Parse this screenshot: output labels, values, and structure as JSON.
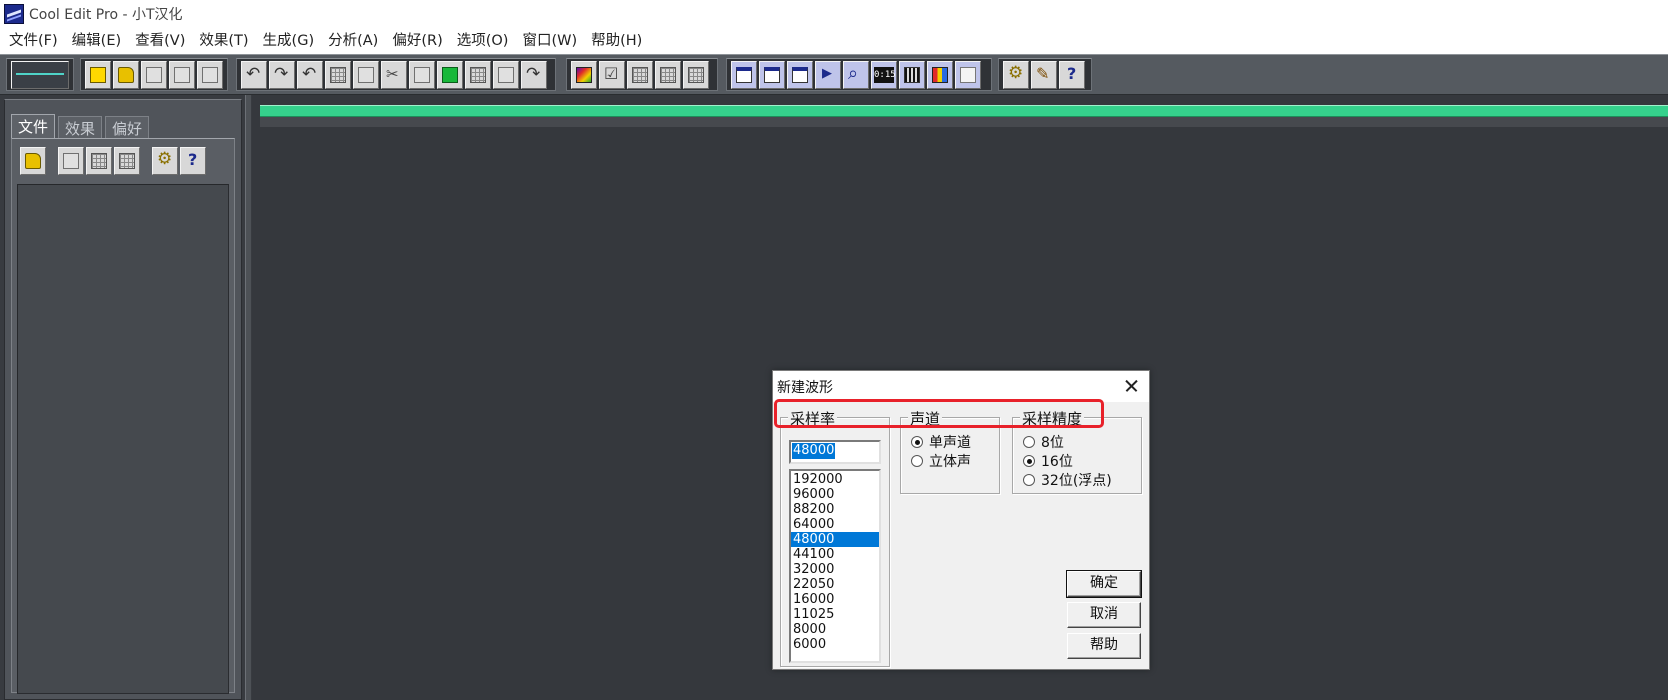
{
  "window": {
    "title": "Cool Edit Pro  - 小T汉化",
    "icon": "app-waveform-icon"
  },
  "menu": [
    {
      "label": "文件(F)"
    },
    {
      "label": "编辑(E)"
    },
    {
      "label": "查看(V)"
    },
    {
      "label": "效果(T)"
    },
    {
      "label": "生成(G)"
    },
    {
      "label": "分析(A)"
    },
    {
      "label": "偏好(R)"
    },
    {
      "label": "选项(O)"
    },
    {
      "label": "窗口(W)"
    },
    {
      "label": "帮助(H)"
    }
  ],
  "left_panel": {
    "tabs": [
      {
        "label": "文件",
        "active": true
      },
      {
        "label": "效果",
        "active": false
      },
      {
        "label": "偏好",
        "active": false
      }
    ]
  },
  "progress_bar_color": "#35d18c",
  "dialog": {
    "title": "新建波形",
    "sample_rate": {
      "label": "采样率",
      "value": "48000",
      "options": [
        "192000",
        "96000",
        "88200",
        "64000",
        "48000",
        "44100",
        "32000",
        "22050",
        "16000",
        "11025",
        "8000",
        "6000"
      ],
      "selected": "48000"
    },
    "channels": {
      "label": "声道",
      "options": [
        {
          "label": "单声道",
          "checked": true
        },
        {
          "label": "立体声",
          "checked": false
        }
      ]
    },
    "resolution": {
      "label": "采样精度",
      "options": [
        {
          "label": "8位",
          "checked": false
        },
        {
          "label": "16位",
          "checked": true
        },
        {
          "label": "32位(浮点)",
          "checked": false
        }
      ]
    },
    "buttons": {
      "ok": "确定",
      "cancel": "取消",
      "help": "帮助"
    }
  },
  "annotation_color": "#e8212a"
}
